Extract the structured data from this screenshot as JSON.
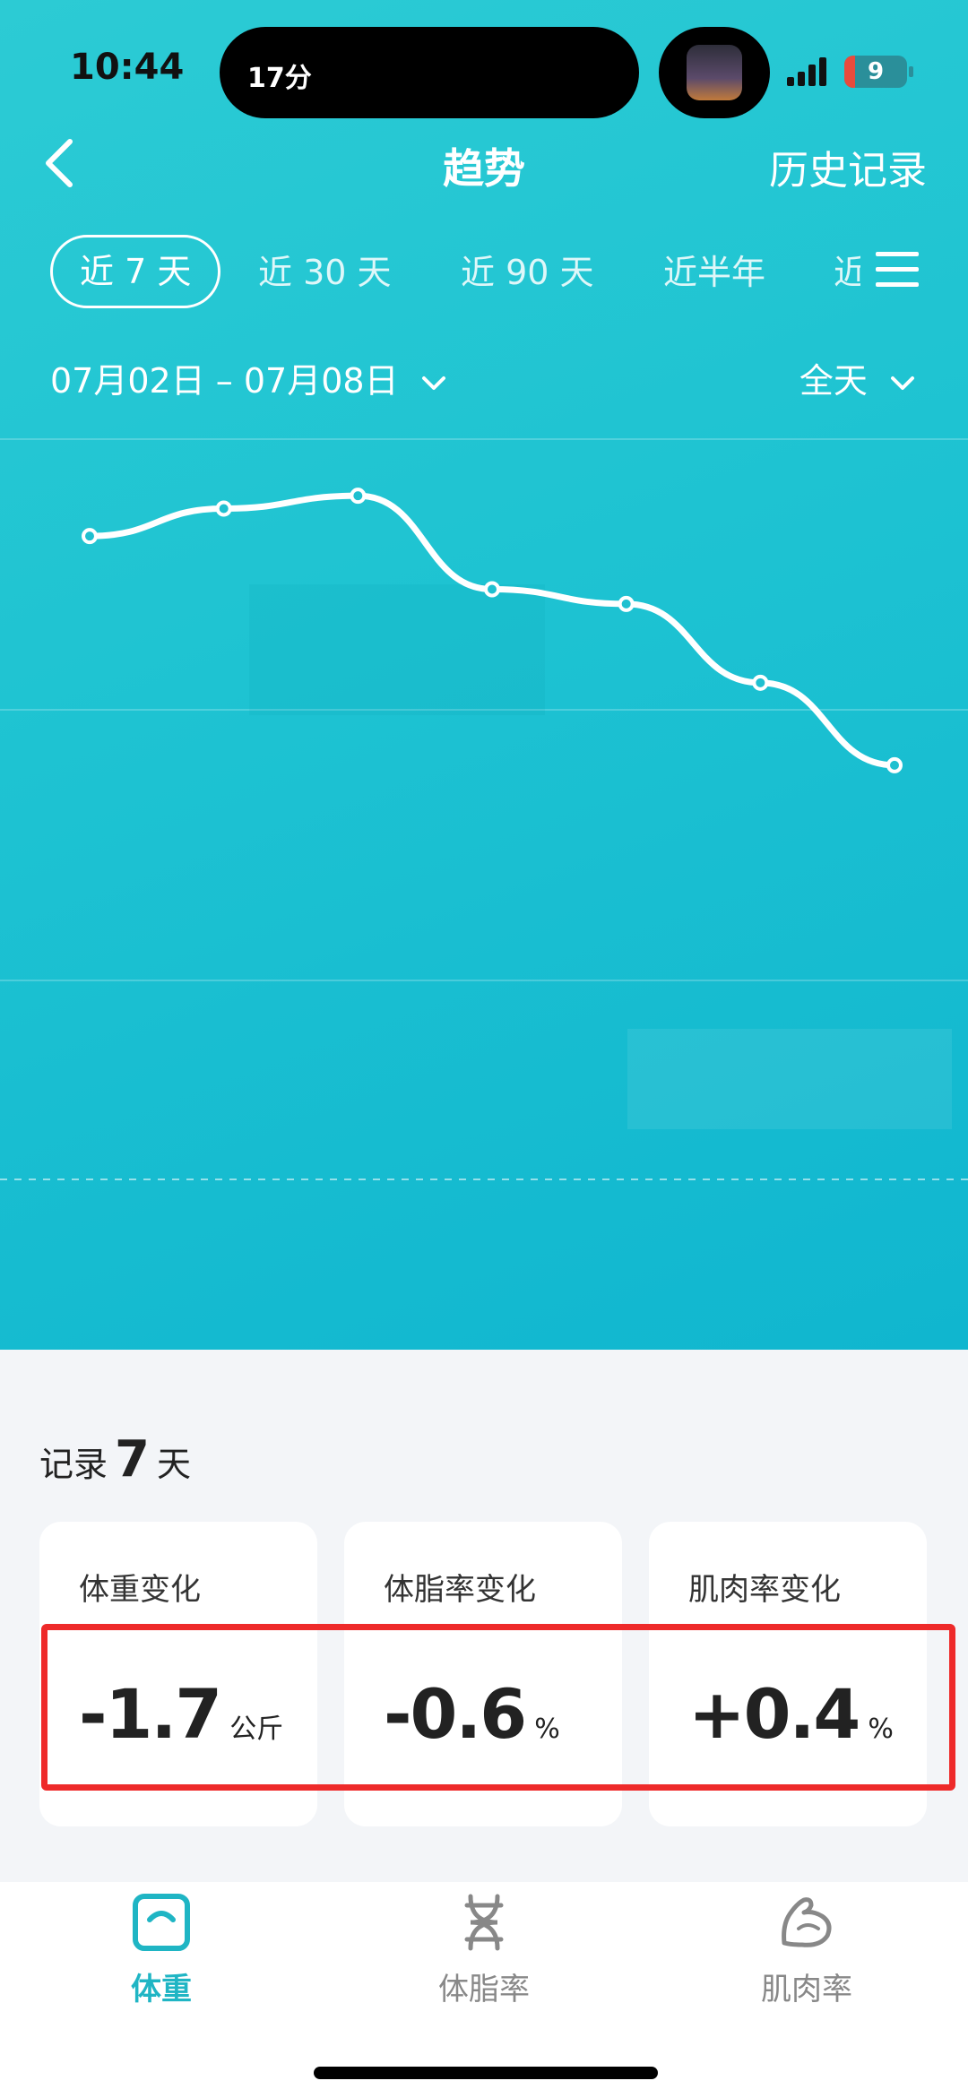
{
  "status_bar": {
    "time": "10:44",
    "island_text": "17分",
    "battery": "9"
  },
  "nav": {
    "title": "趋势",
    "history": "历史记录"
  },
  "tabs": [
    "近 7 天",
    "近 30 天",
    "近 90 天",
    "近半年"
  ],
  "tab_partial": "近",
  "date_range": "07月02日 – 07月08日",
  "time_filter": "全天",
  "chart_data": {
    "type": "line",
    "points": 7,
    "values": [
      77.2,
      78.7,
      79.4,
      74.3,
      73.5,
      69.2,
      64.7
    ],
    "colors": {
      "line": "#ffffff"
    }
  },
  "summary": {
    "prefix": "记录",
    "days": "7",
    "suffix": "天"
  },
  "cards": [
    {
      "label": "体重变化",
      "value": "-1.7",
      "unit": "公斤"
    },
    {
      "label": "体脂率变化",
      "value": "-0.6",
      "unit": "%"
    },
    {
      "label": "肌肉率变化",
      "value": "+0.4",
      "unit": "%"
    }
  ],
  "bottom_nav": [
    {
      "label": "体重",
      "icon": "scale-icon",
      "active": true
    },
    {
      "label": "体脂率",
      "icon": "dna-icon",
      "active": false
    },
    {
      "label": "肌肉率",
      "icon": "muscle-icon",
      "active": false
    }
  ],
  "colors": {
    "accent": "#1fb5c4",
    "annotation": "#ee2a2a"
  }
}
